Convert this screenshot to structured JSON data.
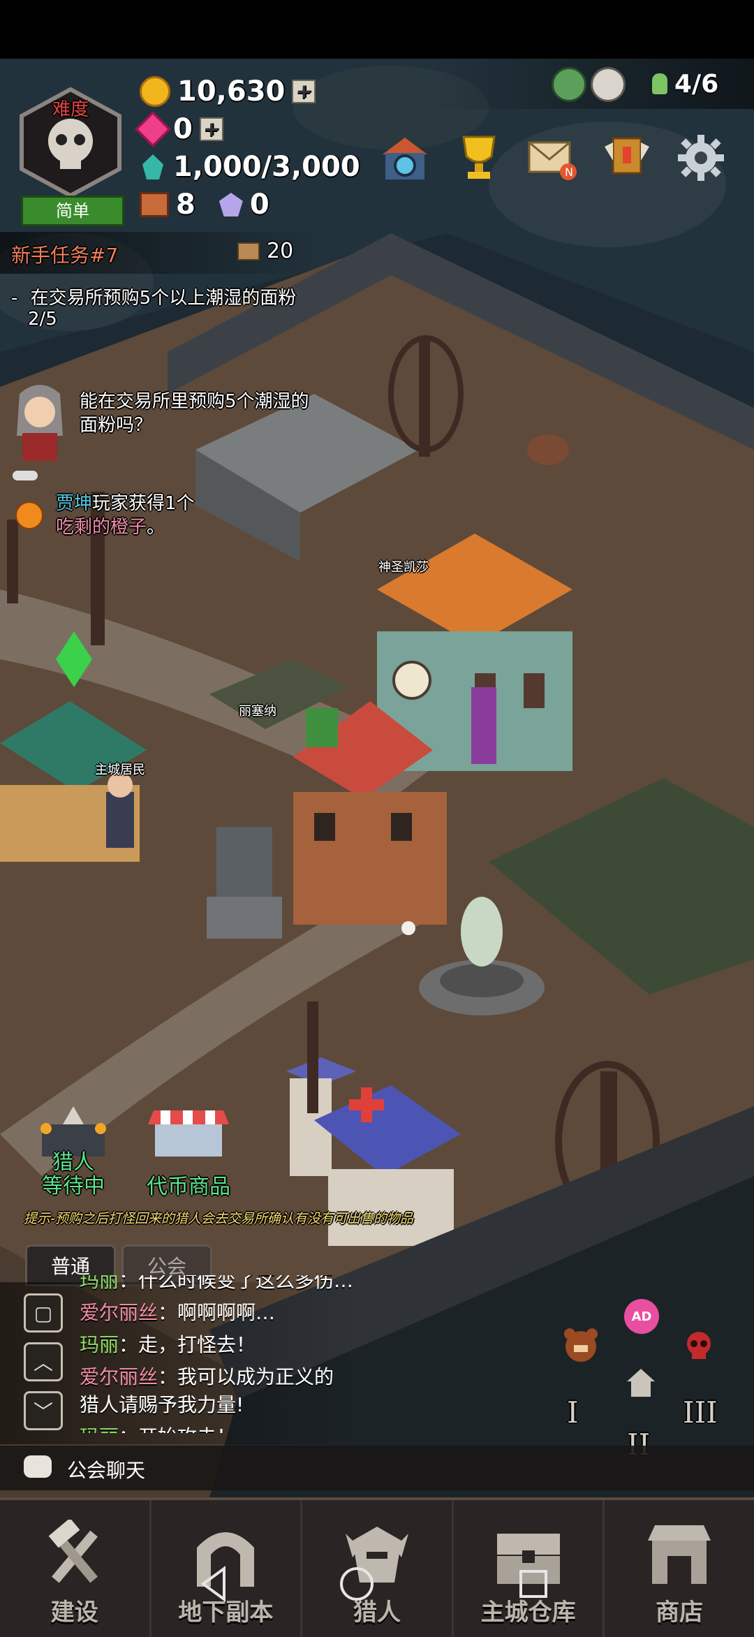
{
  "hud": {
    "difficulty_label": "难度",
    "difficulty_value": "简单",
    "gold": "10,630",
    "gems": "0",
    "energy": "1,000/3,000",
    "chests": "8",
    "crystals": "0",
    "hunters_count": "4/6"
  },
  "quest": {
    "title": "新手任务#7",
    "reward": "20",
    "task_text": "在交易所预购5个以上潮湿的面粉",
    "progress": "2/5",
    "npc_dialog": "能在交易所里预购5个潮湿的面粉吗？"
  },
  "notification": {
    "player": "贾坤",
    "text": "玩家获得1个",
    "item": "吃剩的橙子",
    "suffix": "。"
  },
  "map_labels": {
    "church_label": "神圣凯莎",
    "statue_label": "丽塞纳",
    "resident_label": "主城居民"
  },
  "shortcuts": {
    "hunter_waiting_line1": "猎人",
    "hunter_waiting_line2": "等待中",
    "token_shop": "代币商品"
  },
  "tip": "提示-预购之后打怪回来的猎人会去交易所确认有没有可出售的物品",
  "chat": {
    "tabs": [
      "普通",
      "公会"
    ],
    "messages": [
      {
        "name": "玛丽",
        "sep": "：",
        "text": "什么时候变了这么多伤…",
        "green": true
      },
      {
        "name": "爱尔丽丝",
        "sep": "：",
        "text": "啊啊啊啊…",
        "green": false
      },
      {
        "name": "玛丽",
        "sep": "：",
        "text": "走，打怪去！",
        "green": true
      },
      {
        "name": "爱尔丽丝",
        "sep": "：",
        "text": "我可以成为正义的",
        "green": false
      },
      {
        "name": "",
        "sep": "",
        "text": "猎人请赐予我力量!",
        "green": false
      },
      {
        "name": "玛丽",
        "sep": "：",
        "text": "开始攻击！",
        "green": true
      }
    ],
    "guild_chat": "公会聊天"
  },
  "floor_buttons": [
    "I",
    "II",
    "III"
  ],
  "bottom_nav": [
    "建设",
    "地下副本",
    "猎人",
    "主城仓库",
    "商店"
  ],
  "colors": {
    "gold": "#f2b51d",
    "quest_title": "#f07f5a",
    "chat_pink": "#f08ca6",
    "chat_green": "#8ddb65",
    "notif_blue": "#57c7e3"
  }
}
